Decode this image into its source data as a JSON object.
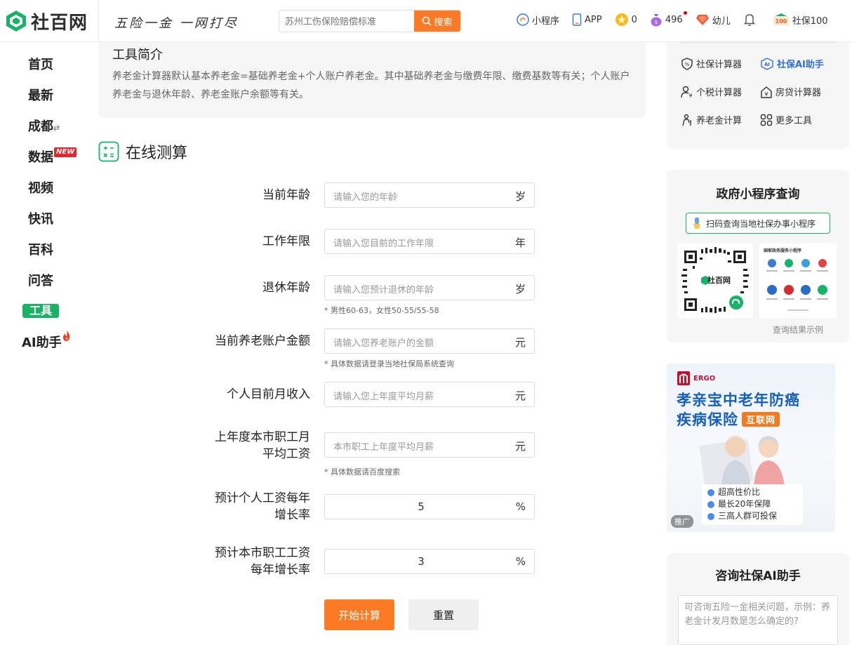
{
  "header": {
    "logo_text": "社百网",
    "slogan": "五险一金 一网打尽",
    "search_placeholder": "苏州工伤保险赔偿标准",
    "search_button": "搜索",
    "nav": {
      "mini_program": "小程序",
      "app": "APP",
      "coins": "0",
      "points": "496",
      "child": "幼儿",
      "user": "社保100"
    }
  },
  "sidebar": {
    "items": [
      "首页",
      "最新",
      "成都",
      "数据",
      "视频",
      "快讯",
      "百科",
      "问答",
      "工具",
      "AI助手"
    ],
    "new_tag": "NEW",
    "switch_glyph": "⇄"
  },
  "intro": {
    "title": "工具简介",
    "text": "养老金计算器默认基本养老金=基础养老金+个人账户养老金。其中基础养老金与缴费年限、缴费基数等有关；个人账户养老金与退休年龄、养老金账户余额等有关。"
  },
  "calculator": {
    "title": "在线测算",
    "fields": [
      {
        "label": "当前年龄",
        "placeholder": "请输入您的年龄",
        "value": "",
        "unit": "岁",
        "note": ""
      },
      {
        "label": "工作年限",
        "placeholder": "请输入您目前的工作年限",
        "value": "",
        "unit": "年",
        "note": ""
      },
      {
        "label": "退休年龄",
        "placeholder": "请输入您预计退休的年龄",
        "value": "",
        "unit": "岁",
        "note": "* 男性60-63，女性50-55/55-58"
      },
      {
        "label": "当前养老账户金额",
        "placeholder": "请输入您养老账户的金额",
        "value": "",
        "unit": "元",
        "note": "* 具体数据请登录当地社保局系统查询"
      },
      {
        "label": "个人目前月收入",
        "placeholder": "请输入您上年度平均月薪",
        "value": "",
        "unit": "元",
        "note": ""
      },
      {
        "label_line1": "上年度本市职工月",
        "label_line2": "平均工资",
        "placeholder": "本市职工上年度平均月薪",
        "value": "",
        "unit": "元",
        "note": "* 具体数据请百度搜索"
      },
      {
        "label_line1": "预计个人工资每年",
        "label_line2": "增长率",
        "placeholder": "",
        "value": "5",
        "unit": "%",
        "note": ""
      },
      {
        "label_line1": "预计本市职工工资",
        "label_line2": "每年增长率",
        "placeholder": "",
        "value": "3",
        "unit": "%",
        "note": ""
      }
    ],
    "submit_label": "开始计算",
    "reset_label": "重置"
  },
  "tools": {
    "items": [
      "社保计算器",
      "社保AI助手",
      "个税计算器",
      "房贷计算器",
      "养老金计算",
      "更多工具"
    ]
  },
  "gov": {
    "title": "政府小程序查询",
    "bubble": "扫码查询当地社保办事小程序",
    "qr_brand": "社百网",
    "screenshot_title": "国家政务服务小程序",
    "caption": "查询结果示例"
  },
  "ad": {
    "brand": "ERGO",
    "title_line1": "孝亲宝中老年防癌",
    "title_line2": "疾病保险",
    "badge": "互联网",
    "bullets": [
      "超高性价比",
      "最长20年保障",
      "三高人群可投保"
    ],
    "tag": "推广"
  },
  "ai": {
    "title": "咨询社保AI助手",
    "placeholder": "可咨询五险一金相关问题，示例：养老金计发月数是怎么确定的?"
  },
  "colors": {
    "brand_green": "#19b368",
    "accent_orange": "#fa7a25",
    "link_blue": "#2f6fd7",
    "hot_red": "#e5262c"
  }
}
